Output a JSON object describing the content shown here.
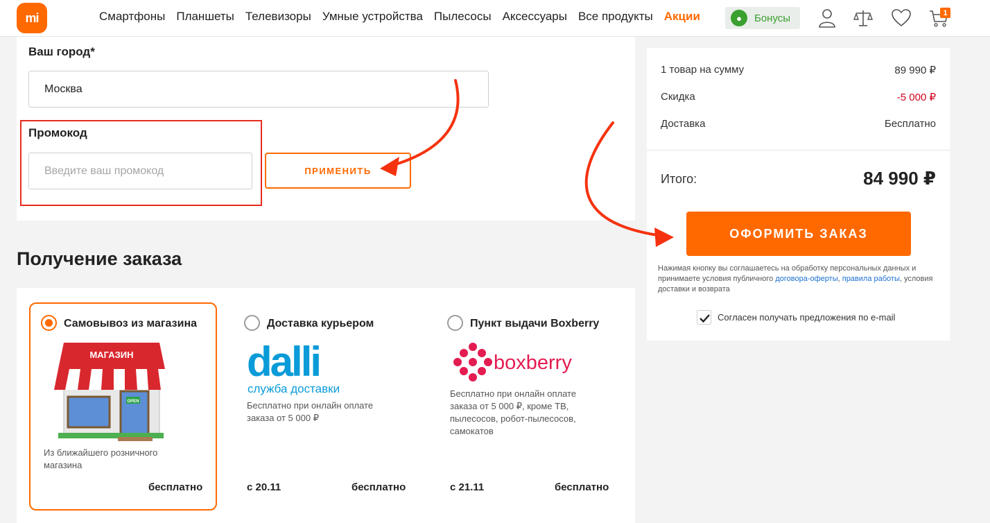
{
  "header": {
    "logo": "mi",
    "nav": [
      "Смартфоны",
      "Планшеты",
      "Телевизоры",
      "Умные устройства",
      "Пылесосы",
      "Аксессуары",
      "Все продукты"
    ],
    "promo": "Акции",
    "bonus": "Бонусы",
    "cart_count": "1",
    "icons": [
      "user-icon",
      "compare-scales-icon",
      "heart-icon",
      "cart-icon"
    ]
  },
  "form": {
    "city_label": "Ваш город*",
    "city_value": "Москва",
    "promo_label": "Промокод",
    "promo_placeholder": "Введите ваш промокод",
    "apply_label": "ПРИМЕНИТЬ"
  },
  "delivery": {
    "title": "Получение заказа",
    "options": [
      {
        "title": "Самовывоз из магазина",
        "sign": "МАГАЗИН",
        "desc": "Из ближайшего розничного магазина",
        "date": "",
        "price": "бесплатно",
        "selected": true
      },
      {
        "title": "Доставка курьером",
        "logo": "dalli",
        "logo_sub": "служба доставки",
        "desc": "Бесплатно при онлайн оплате заказа от 5 000 ₽",
        "date": "с 20.11",
        "price": "бесплатно",
        "selected": false
      },
      {
        "title": "Пункт выдачи Boxberry",
        "logo": "boxberry",
        "desc": "Бесплатно при онлайн оплате заказа от 5 000 ₽, кроме ТВ, пылесосов, робот-пылесосов, самокатов",
        "date": "с 21.11",
        "price": "бесплатно",
        "selected": false
      }
    ]
  },
  "summary": {
    "items_label": "1 товар на сумму",
    "items_value": "89 990 ₽",
    "discount_label": "Скидка",
    "discount_value": "-5 000 ₽",
    "shipping_label": "Доставка",
    "shipping_value": "Бесплатно",
    "total_label": "Итого:",
    "total_value": "84 990 ₽",
    "order_button": "ОФОРМИТЬ ЗАКАЗ",
    "terms_1": "Нажимая кнопку вы соглашаетесь на обработку персональных данных и принимаете условия публичного",
    "terms_link1": "договора-оферты",
    "terms_sep": ",",
    "terms_link2": "правила работы",
    "terms_2": ", условия доставки и возврата",
    "newsletter_label": "Согласен получать предложения по e-mail",
    "newsletter_checked": true
  },
  "colors": {
    "brand": "#ff6900",
    "annotation": "#e52b1e",
    "link": "#1a6fd1",
    "bonus": "#3aa030"
  }
}
